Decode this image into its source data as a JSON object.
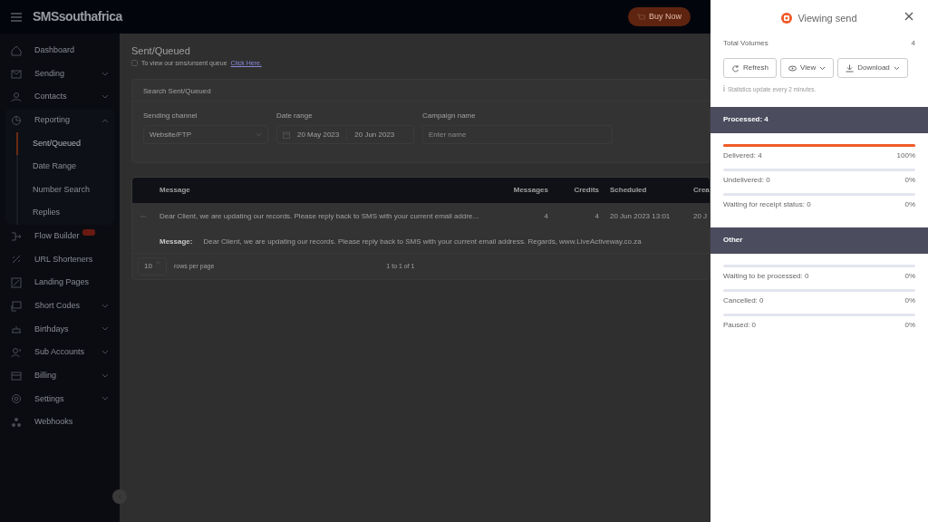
{
  "top_bar": {
    "logo": "SMSsouthafrica",
    "buy_button": "Buy Now"
  },
  "sidebar": {
    "items": [
      {
        "label": "Dashboard",
        "expandable": false,
        "badge": false
      },
      {
        "label": "Sending",
        "expandable": true,
        "expanded": false,
        "badge": false
      },
      {
        "label": "Contacts",
        "expandable": true,
        "expanded": false,
        "badge": false
      },
      {
        "label": "Reporting",
        "expandable": true,
        "expanded": true,
        "badge": false,
        "children": [
          {
            "label": "Sent/Queued",
            "selected": true
          },
          {
            "label": "Date Range",
            "selected": false
          },
          {
            "label": "Number Search",
            "selected": false
          },
          {
            "label": "Replies",
            "selected": false
          }
        ]
      },
      {
        "label": "Flow Builder",
        "expandable": false,
        "badge": true
      },
      {
        "label": "URL Shorteners",
        "expandable": false,
        "badge": false
      },
      {
        "label": "Landing Pages",
        "expandable": false,
        "badge": false
      },
      {
        "label": "Short Codes",
        "expandable": true,
        "expanded": false,
        "badge": false
      },
      {
        "label": "Birthdays",
        "expandable": true,
        "expanded": false,
        "badge": false
      },
      {
        "label": "Sub Accounts",
        "expandable": true,
        "expanded": false,
        "badge": false
      },
      {
        "label": "Billing",
        "expandable": true,
        "expanded": false,
        "badge": false
      },
      {
        "label": "Settings",
        "expandable": true,
        "expanded": false,
        "badge": false
      },
      {
        "label": "Webhooks",
        "expandable": false,
        "badge": false
      }
    ]
  },
  "page": {
    "title": "Sent/Queued",
    "hint": "To view our sms/unsent queue",
    "hint_link": "Click Here.",
    "filter": {
      "title": "Search Sent/Queued",
      "fields": [
        {
          "kind": "select",
          "label": "Sending channel",
          "value": "Website/FTP"
        },
        {
          "kind": "daterange",
          "label": "Date range",
          "from": "20 May 2023",
          "to": "20 Jun 2023"
        },
        {
          "kind": "text",
          "label": "Campaign name",
          "placeholder": "Enter name"
        }
      ]
    },
    "table": {
      "columns": [
        "Message",
        "Messages",
        "Credits",
        "Scheduled",
        "Crea"
      ],
      "rows": [
        {
          "expanded": true,
          "cells": [
            "Dear Client, we are updating our records. Please reply back to SMS with your current email addre...",
            "4",
            "4",
            "20 Jun 2023 13:01",
            "20 J"
          ],
          "detail_label": "Message:",
          "detail_text": "Dear Client, we are updating our records. Please reply back to SMS with your current email address. Regards, www.LiveActiveway.co.za"
        }
      ],
      "page_size": "10",
      "page_size_label": "rows per page",
      "range": "1 to 1 of 1"
    }
  },
  "drawer": {
    "title": "Viewing send",
    "total_label": "Total Volumes",
    "total_value": "4",
    "buttons": [
      {
        "kind": "refresh",
        "label": "Refresh",
        "dropdown": false
      },
      {
        "kind": "view",
        "label": "View",
        "dropdown": true
      },
      {
        "kind": "download",
        "label": "Download",
        "dropdown": true
      }
    ],
    "note": "Statistics update every 2 minutes.",
    "sections": [
      {
        "title": "Processed: 4",
        "rows": [
          {
            "label": "Delivered: 4",
            "percent": "100%",
            "level": 1
          },
          {
            "label": "Undelivered: 0",
            "percent": "0%",
            "level": 0
          },
          {
            "label": "Waiting for receipt status: 0",
            "percent": "0%",
            "level": 0
          }
        ]
      },
      {
        "title": "Other",
        "rows": [
          {
            "label": "Waiting to be processed: 0",
            "percent": "0%",
            "level": 0
          },
          {
            "label": "Cancelled: 0",
            "percent": "0%",
            "level": 0
          },
          {
            "label": "Paused: 0",
            "percent": "0%",
            "level": 0
          }
        ]
      }
    ]
  }
}
